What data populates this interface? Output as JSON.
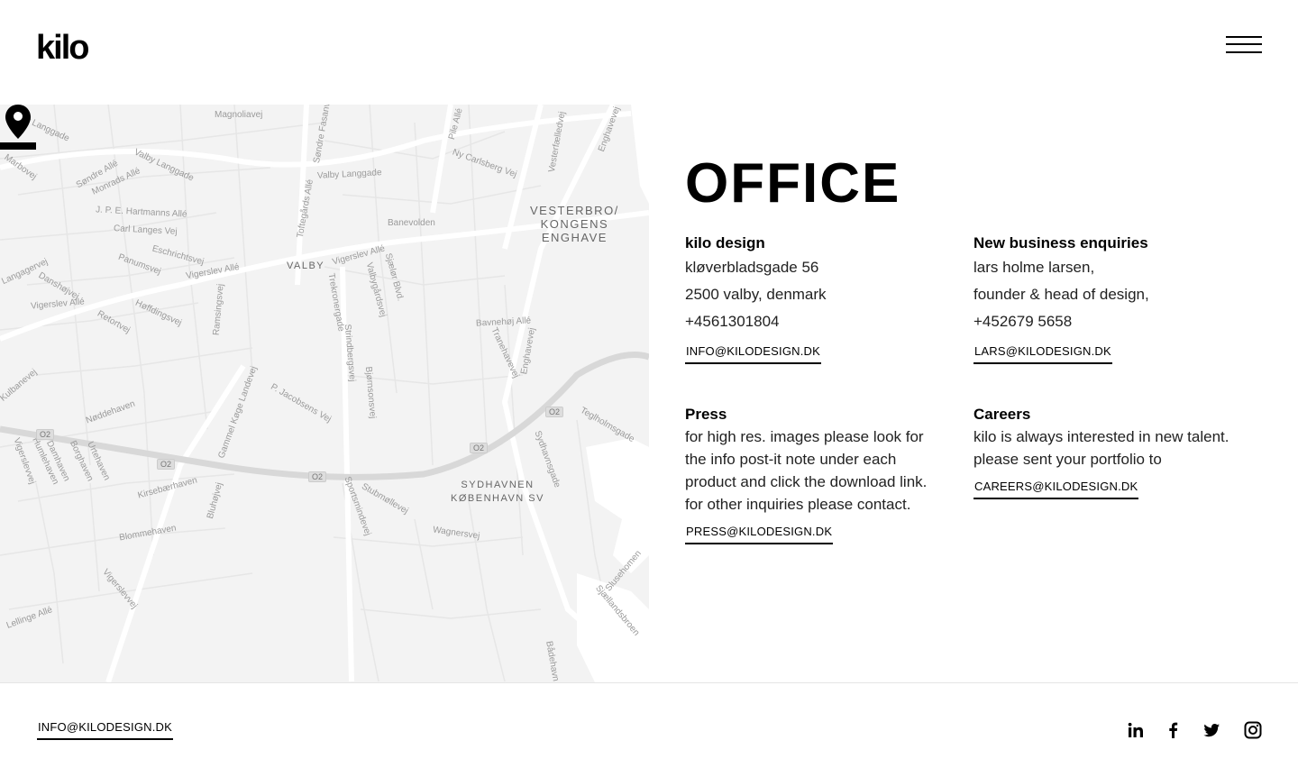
{
  "header": {
    "logo_text": "kilo",
    "menu_icon": "hamburger-menu-icon"
  },
  "map": {
    "districts": [
      {
        "text": "VESTERBRO/\nKONGENS\nENGHAVE"
      },
      {
        "text": "VALBY"
      },
      {
        "text": "SYDHAVNEN\nKØBENHAVN SV"
      }
    ],
    "streets": [
      "Valby Langgade",
      "Magnoliavej",
      "Søndre Fasanvej",
      "Pile Allé",
      "Ny Carlsberg Vej",
      "Vesterfælledvej",
      "Enghavevej",
      "Marbovej",
      "Søndre Allé",
      "Monrads Allé",
      "Valby Langgade",
      "Valby Langgade",
      "J. P. E. Hartmanns Allé",
      "Toftegårds Allé",
      "Banevolden",
      "Carl Langes Vej",
      "Eschrichtsvej",
      "Vigerslev Allé",
      "Panumsvej",
      "Langagervej",
      "Danshøjvej",
      "Vigerslev Allé",
      "Trekronergade",
      "Valbygårdsvej",
      "Sjælør Blvd.",
      "Retortvej",
      "Høffdingsvej",
      "Ramsingsvej",
      "Strindbergsvej",
      "Bjørnsonsvej",
      "Bavnehøj Allé",
      "Tranehavevej",
      "Enghavevej",
      "Kulbanevej",
      "Nøddehaven",
      "Gammel Køge Landevej",
      "P. Jacobsens Vej",
      "Teglholmsgade",
      "Sydhavnsgade",
      "Vigerslevvej",
      "Humlehaven",
      "Damhaven",
      "Borghaven",
      "Urtehaven",
      "Kirsebærhaven",
      "Bluhøjvej",
      "Stubmøllevej",
      "Sportsmindevej",
      "Blommehaven",
      "Wagnersvej",
      "Vigerslevvej",
      "Slusehomen",
      "Sjællandsbroen",
      "Lellinge Allé",
      "Bådehavn"
    ],
    "road_shields": [
      "O2",
      "O2",
      "O2",
      "O2",
      "O2"
    ],
    "pin_icon": "map-marker-icon"
  },
  "office": {
    "title": "OFFICE",
    "company": {
      "heading": "kilo design",
      "lines": [
        "kløverbladsgade 56",
        "2500 valby, denmark",
        "+4561301804"
      ],
      "email": "INFO@KILODESIGN.DK"
    },
    "business": {
      "heading": "New business enquiries",
      "lines": [
        "lars holme larsen,",
        "founder & head of design,",
        "+452679 5658"
      ],
      "email": "LARS@KILODESIGN.DK"
    },
    "press": {
      "heading": "Press",
      "lines": [
        "for high res. images please look for",
        "the info post-it note under each",
        "product and click the download link.",
        "for other inquiries please contact."
      ],
      "email": "PRESS@KILODESIGN.DK"
    },
    "careers": {
      "heading": "Careers",
      "lines": [
        "kilo is always interested in new talent.",
        "please sent your portfolio to"
      ],
      "email": "CAREERS@KILODESIGN.DK"
    }
  },
  "footer": {
    "email": "INFO@KILODESIGN.DK",
    "social": [
      {
        "icon": "linkedin-icon"
      },
      {
        "icon": "facebook-icon"
      },
      {
        "icon": "twitter-icon"
      },
      {
        "icon": "instagram-icon"
      }
    ]
  }
}
